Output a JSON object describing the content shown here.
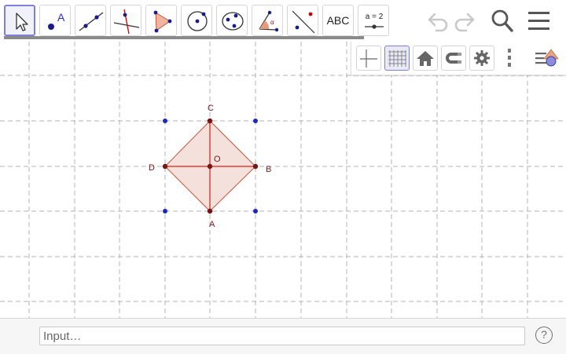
{
  "toolbar": {
    "tools": [
      {
        "icon": "move-arrow-icon"
      },
      {
        "icon": "point-icon",
        "label": "A"
      },
      {
        "icon": "line-icon"
      },
      {
        "icon": "perpendicular-line-icon"
      },
      {
        "icon": "polygon-icon"
      },
      {
        "icon": "circle-center-icon"
      },
      {
        "icon": "ellipse-icon"
      },
      {
        "icon": "angle-icon",
        "label": "α"
      },
      {
        "icon": "reflect-point-icon"
      },
      {
        "icon": "text-icon",
        "label": "ABC"
      },
      {
        "icon": "slider-icon",
        "label": "a = 2"
      }
    ],
    "actions": [
      "undo-icon",
      "redo-icon",
      "search-icon",
      "menu-icon"
    ]
  },
  "style_bar": {
    "buttons": [
      {
        "icon": "axes-icon",
        "active": false
      },
      {
        "icon": "grid-icon",
        "active": true
      },
      {
        "icon": "home-icon",
        "active": false
      },
      {
        "icon": "magnet-icon",
        "active": false
      },
      {
        "icon": "gear-icon",
        "active": false
      },
      {
        "icon": "more-vertical-icon",
        "active": false
      },
      {
        "icon": "algebra-view-toggle-icon",
        "active": false
      }
    ]
  },
  "graphics": {
    "points": {
      "A": "A",
      "B": "B",
      "C": "C",
      "D": "D",
      "O": "O"
    },
    "colors": {
      "polygon_fill": "#f3dcd6",
      "polygon_stroke": "#c3533b",
      "segment": "#e0413a",
      "point": "#7a1515",
      "aux_point": "#1d27b8",
      "grid": "#b3b3b3"
    }
  },
  "input_bar": {
    "placeholder": "Input…",
    "help": "?"
  }
}
